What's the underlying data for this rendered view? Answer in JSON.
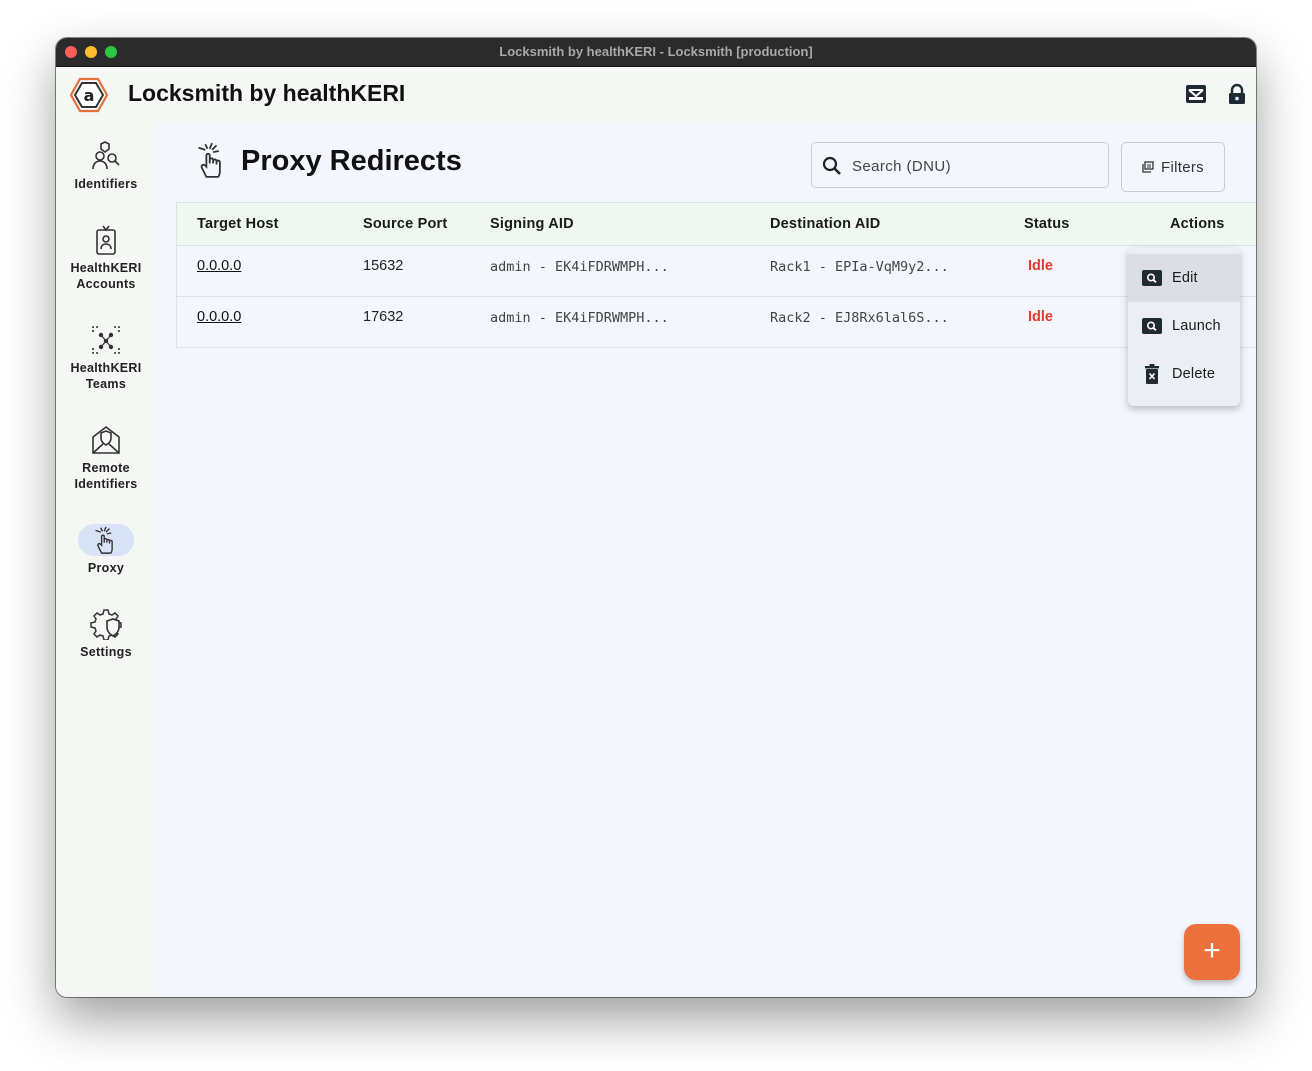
{
  "window": {
    "title": "Locksmith by healthKERI - Locksmith [production]"
  },
  "app": {
    "title": "Locksmith by healthKERI",
    "logo_icon": "healthkeri-logo-icon",
    "toolbar_icons": [
      "inbox-icon",
      "lock-icon"
    ]
  },
  "sidebar": {
    "items": [
      {
        "label": "Identifiers",
        "icon": "identifiers-icon",
        "active": false
      },
      {
        "label": "HealthKERI\nAccounts",
        "icon": "id-badge-icon",
        "active": false
      },
      {
        "label": "HealthKERI\nTeams",
        "icon": "team-network-icon",
        "active": false
      },
      {
        "label": "Remote\nIdentifiers",
        "icon": "envelope-shield-icon",
        "active": false
      },
      {
        "label": "Proxy",
        "icon": "tap-hand-icon",
        "active": true
      },
      {
        "label": "Settings",
        "icon": "gear-shield-icon",
        "active": false
      }
    ]
  },
  "page": {
    "title": "Proxy Redirects",
    "search_placeholder": "Search (DNU)",
    "filters_label": "Filters"
  },
  "table": {
    "headers": [
      "Target Host",
      "Source Port",
      "Signing AID",
      "Destination AID",
      "Status",
      "Actions"
    ],
    "rows": [
      {
        "target_host": "0.0.0.0",
        "source_port": "15632",
        "signing_aid": "admin - EK4iFDRWMPH...",
        "destination_aid": "Rack1 - EPIa-VqM9y2...",
        "status": "Idle"
      },
      {
        "target_host": "0.0.0.0",
        "source_port": "17632",
        "signing_aid": "admin - EK4iFDRWMPH...",
        "destination_aid": "Rack2 - EJ8Rx6lal6S...",
        "status": "Idle"
      }
    ]
  },
  "actions_menu": {
    "items": [
      {
        "label": "Edit",
        "icon": "magnify-icon"
      },
      {
        "label": "Launch",
        "icon": "magnify-icon"
      },
      {
        "label": "Delete",
        "icon": "trash-icon"
      }
    ]
  },
  "fab": {
    "label": "+"
  },
  "colors": {
    "accent": "#ec703c",
    "status_idle": "#e53a2c",
    "nav_active": "#d9e3f7",
    "header_bg": "#eef7f0"
  }
}
